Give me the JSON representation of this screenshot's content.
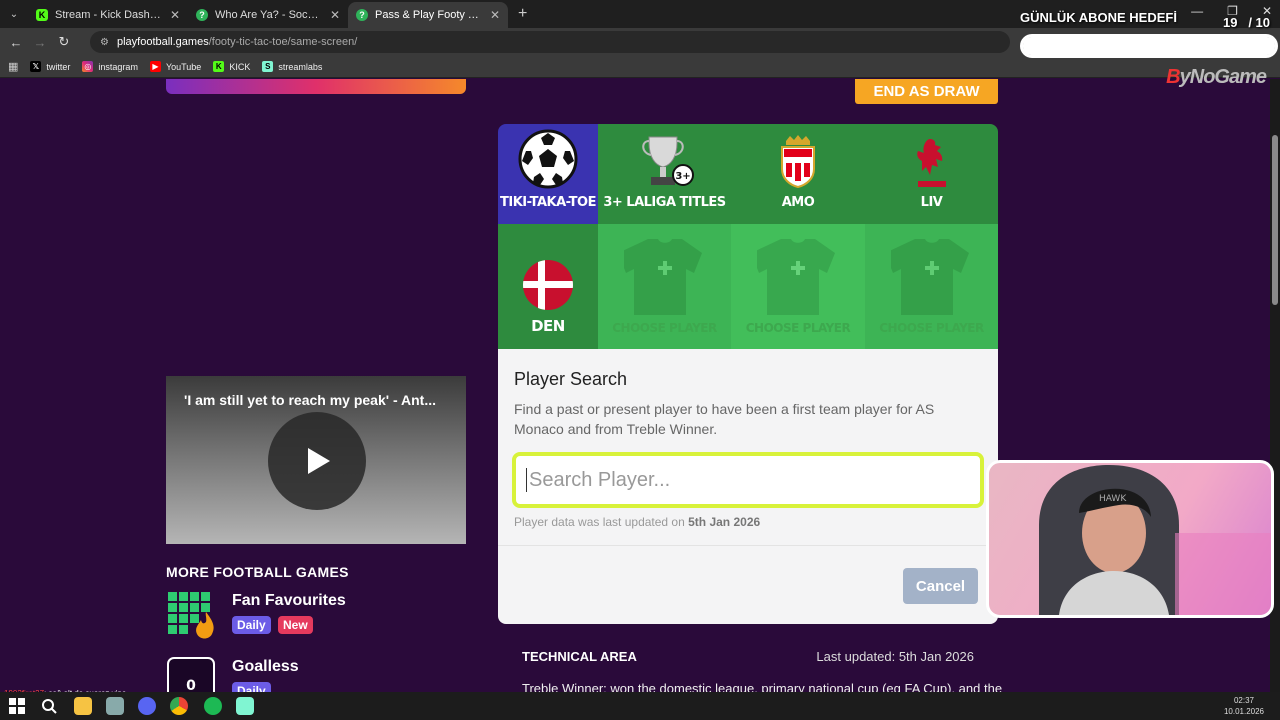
{
  "browser": {
    "tabs": [
      {
        "label": "Stream - Kick Dashboard",
        "icon": "kick-icon",
        "active": false
      },
      {
        "label": "Who Are Ya? - Soccer Quiz",
        "icon": "quiz-icon",
        "active": false
      },
      {
        "label": "Pass & Play Footy Tiki Taka Toe",
        "icon": "quiz-icon",
        "active": true
      }
    ],
    "url_host": "playfootball.games",
    "url_path": "/footy-tic-tac-toe/same-screen/",
    "bookmarks": [
      {
        "label": "twitter",
        "icon": "x-icon"
      },
      {
        "label": "instagram",
        "icon": "instagram-icon"
      },
      {
        "label": "YouTube",
        "icon": "youtube-icon"
      },
      {
        "label": "KICK",
        "icon": "kick-icon"
      },
      {
        "label": "streamlabs",
        "icon": "streamlabs-icon"
      }
    ]
  },
  "overlay": {
    "goal_title": "GÜNLÜK ABONE HEDEFİ",
    "goal_current": "19",
    "goal_total": "/ 10",
    "goal_fill_fraction": 1.0,
    "brand_lead": "B",
    "brand_rest": "yNoGame",
    "chat_user": "1903firat37",
    "chat_message": ": sağ alt da suarez yine"
  },
  "game": {
    "end_draw_label": "END AS DRAW",
    "logo_caption": "TIKI-TAKA-TOE",
    "columns": [
      {
        "caption": "3+ LALIGA TITLES",
        "icon": "trophy-icon",
        "badge": "3+"
      },
      {
        "caption": "AMO",
        "icon": "monaco-crest-icon"
      },
      {
        "caption": "LIV",
        "icon": "liverpool-crest-icon"
      }
    ],
    "rows": [
      {
        "caption": "DEN",
        "icon": "denmark-flag-icon"
      }
    ],
    "choose_label": "CHOOSE PLAYER",
    "colors": {
      "header_green": "#2e8b3e",
      "cell_green": "#3db455",
      "logo_blue": "#3a33b0",
      "accent_yellow": "#d8f23a",
      "end_draw": "#f6a623"
    }
  },
  "search": {
    "title": "Player Search",
    "description": "Find a past or present player to have been a first team player for AS Monaco and from Treble Winner.",
    "placeholder": "Search Player...",
    "updated_prefix": "Player data was last updated on ",
    "updated_date": "5th Jan 2026",
    "cancel_label": "Cancel"
  },
  "technical": {
    "title": "TECHNICAL AREA",
    "updated": "Last updated: 5th Jan 2026",
    "term": "Treble Winner",
    "text": ": won the domestic league, primary national cup (eg FA Cup), and the"
  },
  "sidebar": {
    "video_title": "'I am still yet to reach my peak' - Ant...",
    "more_title": "MORE FOOTBALL GAMES",
    "games": [
      {
        "name": "Fan Favourites",
        "badges": [
          "Daily",
          "New"
        ]
      },
      {
        "name": "Goalless",
        "badges": [
          "Daily"
        ]
      }
    ]
  },
  "taskbar": {
    "time": "02:37",
    "date": "10.01.2026"
  }
}
